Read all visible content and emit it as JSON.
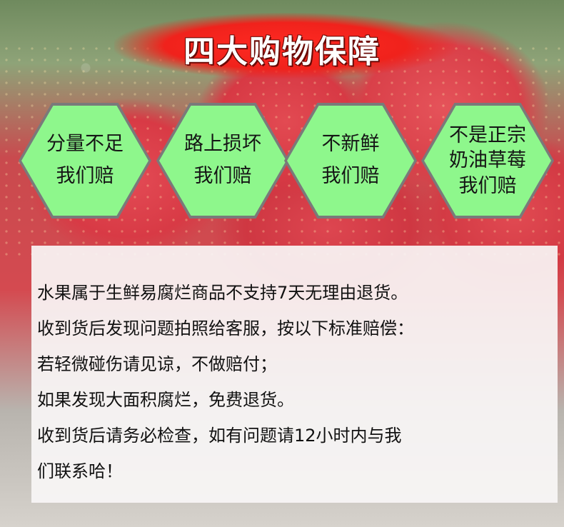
{
  "title": "四大购物保障",
  "guarantees": [
    {
      "lines": [
        "分量不足",
        "我们赔"
      ]
    },
    {
      "lines": [
        "路上损坏",
        "我们赔"
      ]
    },
    {
      "lines": [
        "不新鲜",
        "我们赔"
      ]
    },
    {
      "lines": [
        "不是正宗",
        "奶油草莓",
        "我们赔"
      ]
    }
  ],
  "notice": [
    "水果属于生鲜易腐烂商品不支持7天无理由退货。",
    "收到货后发现问题拍照给客服，按以下标准赔偿：",
    "若轻微碰伤请见谅，不做赔付；",
    "如果发现大面积腐烂，免费退货。",
    "收到货后请务必检查，如有问题请12小时内与我",
    "们联系哈！"
  ]
}
